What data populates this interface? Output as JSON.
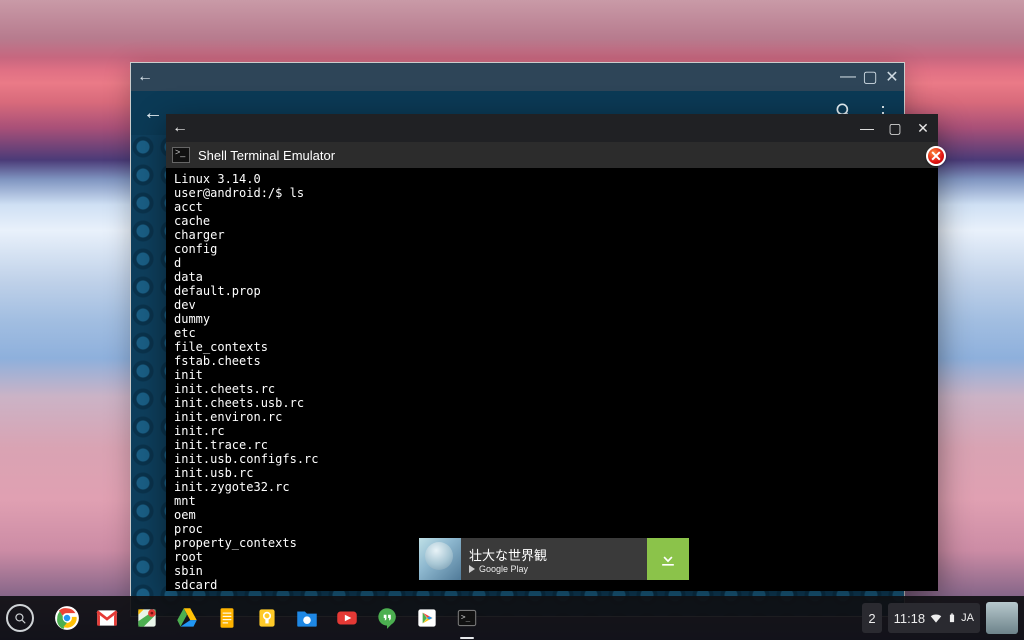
{
  "terminal": {
    "title": "Shell Terminal Emulator",
    "lines": [
      "Linux 3.14.0",
      "user@android:/$ ls",
      "acct",
      "cache",
      "charger",
      "config",
      "d",
      "data",
      "default.prop",
      "dev",
      "dummy",
      "etc",
      "file_contexts",
      "fstab.cheets",
      "init",
      "init.cheets.rc",
      "init.cheets.usb.rc",
      "init.environ.rc",
      "init.rc",
      "init.trace.rc",
      "init.usb.configfs.rc",
      "init.usb.rc",
      "init.zygote32.rc",
      "mnt",
      "oem",
      "proc",
      "property_contexts",
      "root",
      "sbin",
      "sdcard"
    ]
  },
  "ad": {
    "title": "壮大な世界観",
    "store": "Google Play"
  },
  "tray": {
    "notif_count": "2",
    "clock": "11:18",
    "ime": "JA"
  },
  "apps": {
    "launcher": "Launcher",
    "chrome": "Chrome",
    "gmail": "Gmail",
    "maps": "Maps",
    "drive": "Drive",
    "docs": "Docs",
    "keep": "Keep",
    "files": "Files",
    "youtube": "YouTube",
    "hangouts": "Hangouts",
    "play": "Play Store",
    "terminal": "Terminal"
  }
}
